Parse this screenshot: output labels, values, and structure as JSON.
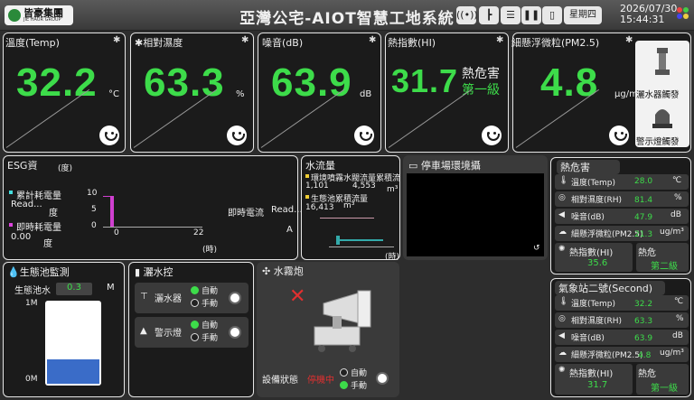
{
  "header": {
    "company": "皆豪集團",
    "company_sub": "JIE HAUR GROUP",
    "title": "亞灣公宅-AIOT智慧工地系統",
    "day": "星期四",
    "date": "2026/07/30",
    "time": "15:44:31",
    "icons": [
      "wifi-icon",
      "tree-icon",
      "list-icon",
      "pause-icon",
      "phone-icon"
    ]
  },
  "metrics": [
    {
      "label": "溫度(Temp)",
      "value": "32.2",
      "unit": "°C"
    },
    {
      "label": "相對濕度",
      "value": "63.3",
      "unit": "%"
    },
    {
      "label": "噪音(dB)",
      "value": "63.9",
      "unit": "dB"
    },
    {
      "label": "熱指數(HI)",
      "value": "31.7",
      "status1": "熱危害",
      "status2": "第一級"
    },
    {
      "label": "細懸浮微粒(PM2.5)",
      "value": "4.8",
      "unit": "μg/m³",
      "side1": "灑水器觸發",
      "side2": "警示燈觸發"
    }
  ],
  "esg": {
    "title": "ESG資",
    "unit_top": "(度)",
    "cum_label": "累計耗電量",
    "cum_value": "Read...",
    "cum_unit": "度",
    "inst_label": "即時耗電量",
    "inst_value": "0.00",
    "inst_unit": "度",
    "current_label": "即時電流",
    "current_value": "Read...",
    "current_unit": "A",
    "yticks": [
      "10",
      "5",
      "0"
    ],
    "xticks": [
      "0",
      "22"
    ],
    "xunit": "(時)"
  },
  "water": {
    "title": "水流量",
    "line1": "環境噴霧水閥流量累積流量",
    "v1": "1,101",
    "v1b": "4,553",
    "unit": "m³",
    "line2": "生態池累積流量",
    "v2": "16,413",
    "xunit": "(時)"
  },
  "parking": {
    "title": "停車場環境攝"
  },
  "heat": {
    "title": "熱危害",
    "rows": [
      {
        "icon": "thermometer-icon",
        "label": "溫度(Temp)",
        "value": "28.0",
        "unit": "℃"
      },
      {
        "icon": "humidity-icon",
        "label": "相對濕度(RH)",
        "value": "81.4",
        "unit": "%"
      },
      {
        "icon": "speaker-icon",
        "label": "噪音(dB)",
        "value": "47.9",
        "unit": "dB"
      },
      {
        "icon": "cloud-icon",
        "label": "細懸浮微粒(PM2.5)",
        "value": "21.3",
        "unit": "ug/m³"
      }
    ],
    "hi_label": "熱指數(HI)",
    "hi_value": "35.6",
    "danger_label": "熱危",
    "danger_value": "第二級"
  },
  "station2": {
    "title": "氣象站二號(Second)",
    "rows": [
      {
        "icon": "thermometer-icon",
        "label": "溫度(Temp)",
        "value": "32.2",
        "unit": "℃"
      },
      {
        "icon": "humidity-icon",
        "label": "相對濕度(RH)",
        "value": "63.3",
        "unit": "%"
      },
      {
        "icon": "speaker-icon",
        "label": "噪音(dB)",
        "value": "63.9",
        "unit": "dB"
      },
      {
        "icon": "cloud-icon",
        "label": "細懸浮微粒(PM2.5)",
        "value": "4.8",
        "unit": "ug/m³"
      }
    ],
    "hi_label": "熱指數(HI)",
    "hi_value": "31.7",
    "danger_label": "熱危",
    "danger_value": "第一級"
  },
  "pond": {
    "title": "生態池監測",
    "label": "生態池水",
    "value": "0.3",
    "unit": "M",
    "top": "1M",
    "bottom": "0M",
    "level": 0.3
  },
  "sprinkler": {
    "title": "灑水控",
    "dev1": "灑水器",
    "dev2": "警示燈",
    "auto": "自動",
    "manual": "手動"
  },
  "cannon": {
    "title": "水霧炮",
    "status_label": "設備狀態",
    "status_value": "停機中",
    "auto": "自動",
    "manual": "手動"
  },
  "colors": {
    "accent": "#3ddc4a",
    "panel": "#1b1b1b",
    "bg": "#2d2d2d",
    "alert": "#e03030"
  }
}
